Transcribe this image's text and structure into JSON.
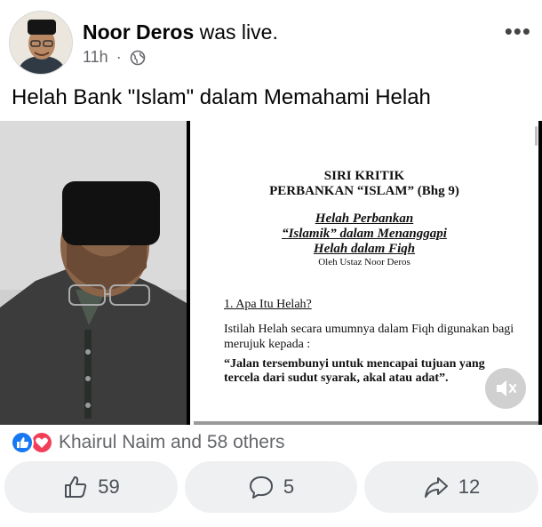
{
  "post": {
    "author": "Noor Deros",
    "action": "was live.",
    "time": "11h",
    "separator": "·",
    "caption": "Helah Bank \"Islam\" dalam Memahami Helah"
  },
  "slide": {
    "title_line1": "SIRI KRITIK",
    "title_line2": "PERBANKAN “ISLAM” (Bhg 9)",
    "subtitle_line1": "Helah Perbankan",
    "subtitle_line2": "“Islamik” dalam Menanggapi",
    "subtitle_line3": "Helah dalam Fiqh",
    "byline": "Oleh Ustaz Noor Deros",
    "section": "1. Apa Itu Helah?",
    "body": "Istilah Helah secara umumnya dalam Fiqh digunakan bagi merujuk kepada :",
    "quote": "“Jalan tersembunyi untuk mencapai tujuan yang tercela dari sudut syarak, akal atau adat”."
  },
  "reactions": {
    "summary": "Khairul Naim and 58 others"
  },
  "actions": {
    "like_count": "59",
    "comment_count": "5",
    "share_count": "12"
  },
  "colors": {
    "like_blue": "#1877f2",
    "love_red": "#f33e58",
    "meta_gray": "#65676b",
    "button_bg": "#eef0f2"
  },
  "icons": [
    "globe-icon",
    "more-options-icon",
    "like-reaction-icon",
    "love-reaction-icon",
    "mute-icon",
    "thumbs-up-icon",
    "comment-icon",
    "share-icon"
  ]
}
